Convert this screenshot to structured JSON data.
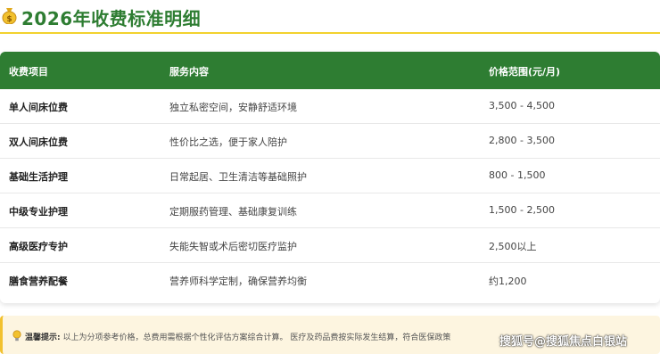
{
  "title": "2026年收费标准明细",
  "table": {
    "headers": [
      "收费项目",
      "服务内容",
      "价格范围(元/月)"
    ],
    "rows": [
      {
        "item": "单人间床位费",
        "content": "独立私密空间，安静舒适环境",
        "price": "3,500 - 4,500"
      },
      {
        "item": "双人间床位费",
        "content": "性价比之选，便于家人陪护",
        "price": "2,800 - 3,500"
      },
      {
        "item": "基础生活护理",
        "content": "日常起居、卫生清洁等基础照护",
        "price": "800 - 1,500"
      },
      {
        "item": "中级专业护理",
        "content": "定期服药管理、基础康复训练",
        "price": "1,500 - 2,500"
      },
      {
        "item": "高级医疗专护",
        "content": "失能失智或术后密切医疗监护",
        "price": "2,500以上"
      },
      {
        "item": "膳食营养配餐",
        "content": "营养师科学定制，确保营养均衡",
        "price": "约1,200"
      }
    ]
  },
  "note": {
    "label": "温馨提示:",
    "text": "以上为分项参考价格，总费用需根据个性化评估方案综合计算。 医疗及药品费按实际发生结算，符合医保政策"
  },
  "watermark": "搜狐号@搜狐焦点白银站",
  "colors": {
    "accent": "#2e7d32",
    "highlight": "#f2d22e",
    "note_bg": "#fdf5e0"
  }
}
